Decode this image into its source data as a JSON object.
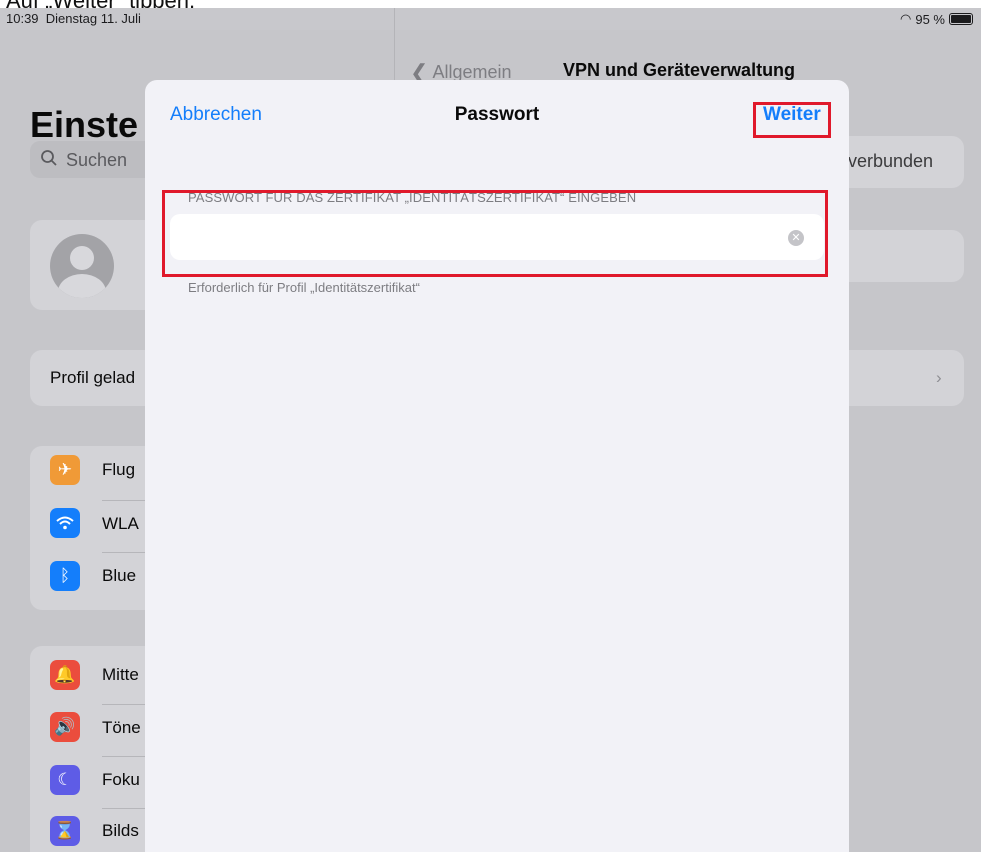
{
  "caption": "Auf „Weiter“ tippen.",
  "status_bar": {
    "time": "10:39",
    "date": "Dienstag 11. Juli",
    "battery": "95 %"
  },
  "sidebar": {
    "title": "Einste",
    "search_placeholder": "Suchen",
    "profile_banner": "Profil gelad",
    "group1": [
      {
        "label": "Flug",
        "icon": "airplane-icon",
        "color": "#f09a37"
      },
      {
        "label": "WLA",
        "icon": "wifi-icon",
        "color": "#147efb"
      },
      {
        "label": "Blue",
        "icon": "bluetooth-icon",
        "color": "#147efb"
      }
    ],
    "group2": [
      {
        "label": "Mitte",
        "icon": "notification-bell-icon",
        "color": "#eb4d3d"
      },
      {
        "label": "Töne",
        "icon": "speaker-icon",
        "color": "#eb4d3d"
      },
      {
        "label": "Foku",
        "icon": "moon-icon",
        "color": "#5e5ce6"
      },
      {
        "label": "Bilds",
        "icon": "hourglass-icon",
        "color": "#5e5ce6"
      }
    ]
  },
  "detail": {
    "back_label": "Allgemein",
    "title": "VPN und Geräteverwaltung",
    "row_partial": "verbunden"
  },
  "modal": {
    "cancel_label": "Abbrechen",
    "title": "Passwort",
    "next_label": "Weiter",
    "section_header": "PASSWORT FÜR DAS ZERTIFIKAT „IDENTITÄTSZERTIFIKAT“ EINGEBEN",
    "password_value": "",
    "footer": "Erforderlich für Profil „Identitätszertifikat“"
  },
  "colors": {
    "accent": "#147efb",
    "highlight": "#e0192b"
  }
}
